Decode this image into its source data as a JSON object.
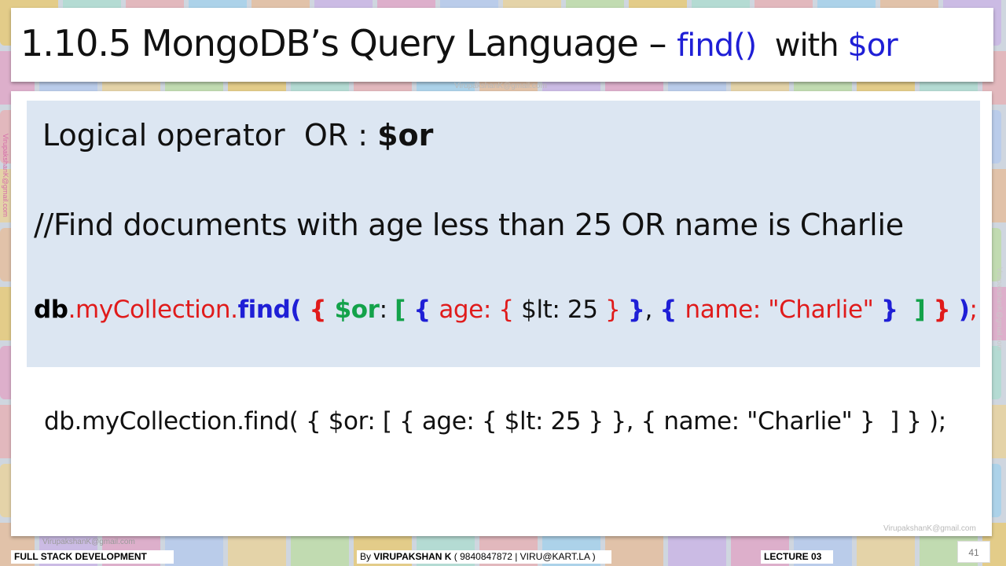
{
  "slide": {
    "title_main": "1.10.5 MongoDB’s Query Language – ",
    "title_find": "find()",
    "title_with": "  with ",
    "title_or": "$or",
    "operator_label": "Logical operator  OR : ",
    "operator_symbol": "$or",
    "comment": "//Find documents with age less than 25 OR name is Charlie",
    "code_plain": "db.myCollection.find( { $or: [ { age: { $lt: 25 } }, { name: \"Charlie\" }  ] } );",
    "code_tokens": [
      {
        "text": "db",
        "cls": "c-black"
      },
      {
        "text": ".myCollection.",
        "cls": "c-red"
      },
      {
        "text": "find(",
        "cls": "c-blue-b"
      },
      {
        "text": " { ",
        "cls": "c-red-b"
      },
      {
        "text": "$or",
        "cls": "c-green-b"
      },
      {
        "text": ": ",
        "cls": "c-plain"
      },
      {
        "text": "[ ",
        "cls": "c-green-b"
      },
      {
        "text": "{ ",
        "cls": "c-blue-b"
      },
      {
        "text": "age: { ",
        "cls": "c-red"
      },
      {
        "text": "$lt: 25 ",
        "cls": "c-plain"
      },
      {
        "text": "} ",
        "cls": "c-red"
      },
      {
        "text": "}",
        "cls": "c-blue-b"
      },
      {
        "text": ", ",
        "cls": "c-plain"
      },
      {
        "text": "{ ",
        "cls": "c-blue-b"
      },
      {
        "text": "name: \"Charlie\" ",
        "cls": "c-red"
      },
      {
        "text": "}  ",
        "cls": "c-blue-b"
      },
      {
        "text": "] ",
        "cls": "c-green-b"
      },
      {
        "text": "} ",
        "cls": "c-red-b"
      },
      {
        "text": ")",
        "cls": "c-blue-b"
      },
      {
        "text": ";",
        "cls": "c-red"
      }
    ]
  },
  "watermarks": {
    "email": "VirupakshanK@gmail.com"
  },
  "footer": {
    "course": "FULL STACK DEVELOPMENT",
    "author_prefix": "By ",
    "author_name": "VIRUPAKSHAN K",
    "author_contact": " ( 9840847872 | VIRU@KART.LA )",
    "lecture": "LECTURE 03",
    "page_number": "41"
  },
  "colors": {
    "accent_blue": "#1f1fd6",
    "accent_red": "#e01b1b",
    "accent_green": "#13a24a",
    "panel_bg": "#dce6f2"
  }
}
